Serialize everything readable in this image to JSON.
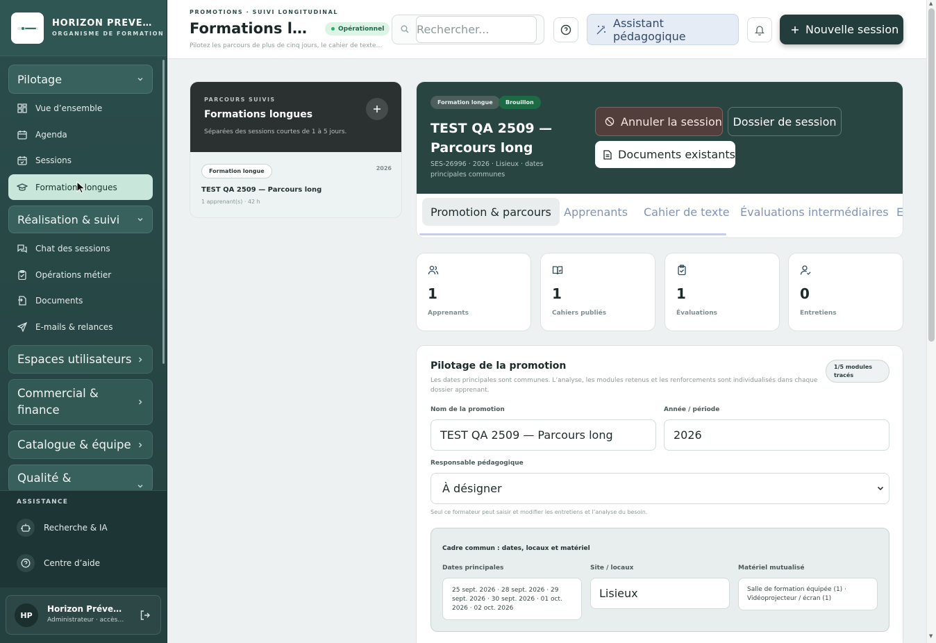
{
  "brand": {
    "name": "HORIZON PRÉVENTION",
    "subtitle": "ORGANISME DE FORMATION"
  },
  "sidebar": {
    "groups": [
      {
        "label": "Pilotage",
        "icon": "chevron-down-icon"
      },
      {
        "label": "Réalisation & suivi",
        "icon": "chevron-down-icon"
      },
      {
        "label": "Espaces utilisateurs",
        "icon": "chevron-right-icon"
      },
      {
        "label": "Commercial & finance",
        "icon": "chevron-right-icon"
      },
      {
        "label": "Catalogue & équipe",
        "icon": "chevron-right-icon"
      },
      {
        "label": "Qualité &",
        "icon": "chevron-down-icon"
      }
    ],
    "pilotage_items": [
      {
        "label": "Vue d’ensemble",
        "icon": "dashboard-icon"
      },
      {
        "label": "Agenda",
        "icon": "calendar-icon"
      },
      {
        "label": "Sessions",
        "icon": "calendar-check-icon"
      },
      {
        "label": "Formations longues",
        "icon": "graduation-cap-icon",
        "active": true
      }
    ],
    "realisation_items": [
      {
        "label": "Chat des sessions",
        "icon": "chat-icon"
      },
      {
        "label": "Opérations métier",
        "icon": "clipboard-icon"
      },
      {
        "label": "Documents",
        "icon": "document-icon"
      },
      {
        "label": "E-mails & relances",
        "icon": "send-icon"
      }
    ],
    "assistance": {
      "label": "ASSISTANCE",
      "items": [
        {
          "label": "Recherche & IA",
          "icon": "robot-icon"
        },
        {
          "label": "Centre d’aide",
          "icon": "help-circle-icon"
        }
      ]
    },
    "user": {
      "initials": "HP",
      "name": "Horizon Prévention",
      "role": "Administrateur · accès sans restriction"
    }
  },
  "header": {
    "eyebrow": "PROMOTIONS · SUIVI LONGITUDINAL",
    "title": "Formations longues",
    "status": "Opérationnel",
    "subtitle": "Pilotez les parcours de plus de cinq jours, le cahier de texte, les évaluations",
    "search_placeholder": "Rechercher...",
    "assistant_label": "Assistant pédagogique",
    "new_session_label": "Nouvelle session"
  },
  "left_panel": {
    "eyebrow": "PARCOURS SUIVIS",
    "title": "Formations longues",
    "subtitle": "Séparées des sessions courtes de 1 à 5 jours.",
    "item": {
      "tag": "Formation longue",
      "year": "2026",
      "name": "TEST QA 2509 — Parcours long",
      "meta": "1 apprenant(s) · 42 h"
    }
  },
  "session": {
    "tags": [
      "Formation longue",
      "Brouillon"
    ],
    "title": "TEST QA 2509 — Parcours long",
    "meta": "SES-26996 · 2026 · Lisieux · dates principales communes",
    "cancel_label": "Annuler la session",
    "dossier_label": "Dossier de session",
    "documents_label": "Documents existants",
    "tabs": [
      "Promotion & parcours",
      "Apprenants",
      "Cahier de texte",
      "Évaluations intermédiaires",
      "E"
    ]
  },
  "kpis": [
    {
      "value": "1",
      "label": "Apprenants",
      "icon": "users-icon"
    },
    {
      "value": "1",
      "label": "Cahiers publiés",
      "icon": "book-open-icon"
    },
    {
      "value": "1",
      "label": "Évaluations",
      "icon": "clipboard-check-icon"
    },
    {
      "value": "0",
      "label": "Entretiens",
      "icon": "user-check-icon"
    }
  ],
  "pilotage": {
    "title": "Pilotage de la promotion",
    "description": "Les dates principales sont communes. L’analyse, les modules retenus et les renforcements sont individualisés dans chaque dossier apprenant.",
    "badge": "1/5 modules tracés",
    "promo_name_label": "Nom de la promotion",
    "promo_name_value": "TEST QA 2509 — Parcours long",
    "year_label": "Année / période",
    "year_value": "2026",
    "responsable_label": "Responsable pédagogique",
    "responsable_value": "À désigner",
    "responsable_hint": "Seul ce formateur peut saisir et modifier les entretiens et l’analyse du besoin.",
    "cadre": {
      "title": "Cadre commun : dates, locaux et matériel",
      "dates_label": "Dates principales",
      "dates_value": "25 sept. 2026 · 28 sept. 2026 · 29 sept. 2026 · 30 sept. 2026 · 01 oct. 2026 · 02 oct. 2026",
      "site_label": "Site / locaux",
      "site_value": "Lisieux",
      "materiel_label": "Matériel mutualisé",
      "materiel_value": "Salle de formation équipée (1) · Vidéoprojecteur / écran (1)"
    }
  }
}
